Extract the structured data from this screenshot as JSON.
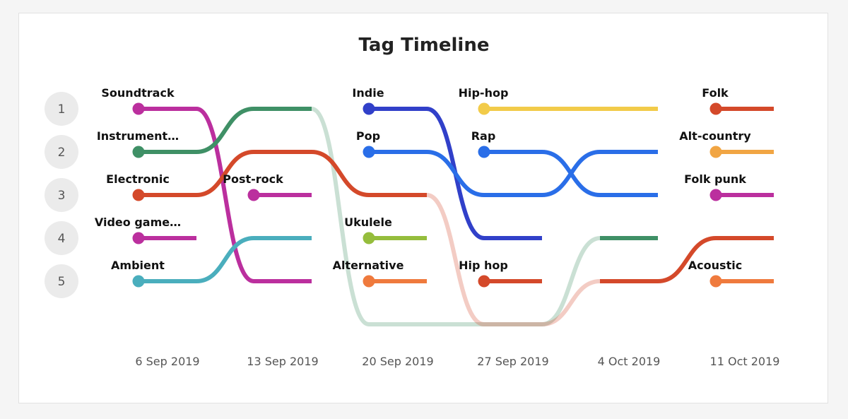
{
  "chart_data": {
    "type": "line",
    "title": "Tag Timeline",
    "ranks": [
      "1",
      "2",
      "3",
      "4",
      "5"
    ],
    "x": [
      "6 Sep 2019",
      "13 Sep 2019",
      "20 Sep 2019",
      "27 Sep 2019",
      "4 Oct 2019",
      "11 Oct 2019"
    ],
    "y_reversed": true,
    "below_rank": 6,
    "grid": false,
    "series": [
      {
        "name": "Soundtrack",
        "color": "#bb2f9e",
        "start": 0,
        "ranks": [
          1,
          5
        ]
      },
      {
        "name": "Instrument…",
        "color": "#3f9066",
        "start": 0,
        "ranks": [
          2,
          1,
          6,
          6,
          4
        ]
      },
      {
        "name": "Electronic",
        "color": "#d4492a",
        "start": 0,
        "ranks": [
          3,
          2,
          3,
          6,
          5,
          4
        ]
      },
      {
        "name": "Video game…",
        "color": "#bb2f9e",
        "start": 0,
        "ranks": [
          4
        ]
      },
      {
        "name": "Ambient",
        "color": "#4aaebd",
        "start": 0,
        "ranks": [
          5,
          4
        ]
      },
      {
        "name": "Post-rock",
        "color": "#bb2f9e",
        "start": 1,
        "ranks": [
          3
        ]
      },
      {
        "name": "Indie",
        "color": "#3140c9",
        "start": 2,
        "ranks": [
          1,
          4
        ]
      },
      {
        "name": "Pop",
        "color": "#2a6ee8",
        "start": 2,
        "ranks": [
          2,
          3,
          2
        ]
      },
      {
        "name": "Ukulele",
        "color": "#95bd3c",
        "start": 2,
        "ranks": [
          4
        ]
      },
      {
        "name": "Alternative",
        "color": "#ef7a3d",
        "start": 2,
        "ranks": [
          5
        ]
      },
      {
        "name": "Hip-hop",
        "color": "#f2cb49",
        "start": 3,
        "ranks": [
          1,
          1
        ]
      },
      {
        "name": "Rap",
        "color": "#2a6ee8",
        "start": 3,
        "ranks": [
          2,
          3
        ]
      },
      {
        "name": "Hip hop",
        "color": "#d4492a",
        "start": 3,
        "ranks": [
          5
        ]
      },
      {
        "name": "Folk",
        "color": "#d4492a",
        "start": 5,
        "ranks": [
          1
        ]
      },
      {
        "name": "Alt-country",
        "color": "#f1a543",
        "start": 5,
        "ranks": [
          2
        ]
      },
      {
        "name": "Folk punk",
        "color": "#bb2f9e",
        "start": 5,
        "ranks": [
          3
        ]
      },
      {
        "name": "Acoustic",
        "color": "#ef7a3d",
        "start": 5,
        "ranks": [
          5
        ]
      }
    ]
  }
}
